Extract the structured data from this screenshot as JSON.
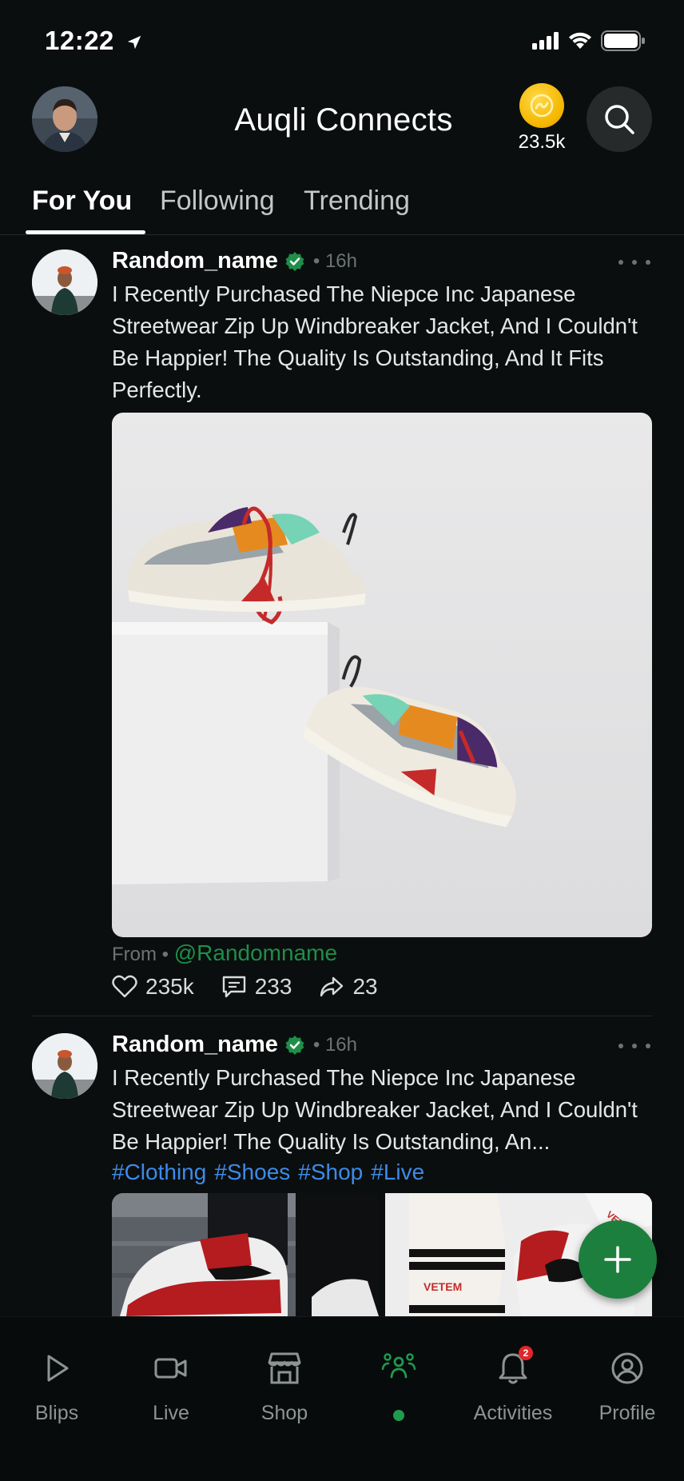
{
  "status_bar": {
    "time": "12:22"
  },
  "header": {
    "title": "Auqli Connects",
    "coin_count": "23.5k"
  },
  "tabs": [
    {
      "label": "For You",
      "active": true
    },
    {
      "label": "Following",
      "active": false
    },
    {
      "label": "Trending",
      "active": false
    }
  ],
  "posts": [
    {
      "author": "Random_name",
      "time": "• 16h",
      "text": "I Recently Purchased The Niepce Inc Japanese Streetwear Zip Up Windbreaker Jacket, And I Couldn't Be Happier! The Quality Is Outstanding, And It Fits Perfectly.",
      "from_label": "From •",
      "from_handle": "@Randomname",
      "likes": "235k",
      "comments": "233",
      "shares": "23"
    },
    {
      "author": "Random_name",
      "time": "• 16h",
      "text": "I Recently Purchased The Niepce Inc Japanese Streetwear Zip Up Windbreaker Jacket, And I Couldn't Be Happier! The Quality Is Outstanding, An...",
      "hashtags": [
        "#Clothing",
        "#Shoes",
        "#Shop",
        "#Live"
      ],
      "image_tags": [
        "VETEM",
        "VETE"
      ]
    }
  ],
  "bottom_nav": [
    {
      "label": "Blips",
      "icon": "play-icon"
    },
    {
      "label": "Live",
      "icon": "video-camera-icon"
    },
    {
      "label": "Shop",
      "icon": "store-icon"
    },
    {
      "label": "",
      "icon": "community-icon",
      "active": true
    },
    {
      "label": "Activities",
      "icon": "bell-icon",
      "badge": "2"
    },
    {
      "label": "Profile",
      "icon": "user-circle-icon"
    }
  ],
  "colors": {
    "accent_green": "#1f8e49",
    "fab_green": "#1d7f3d",
    "hashtag_blue": "#3c8bea",
    "coin_gold": "#f5b700",
    "badge_red": "#e0262b"
  }
}
